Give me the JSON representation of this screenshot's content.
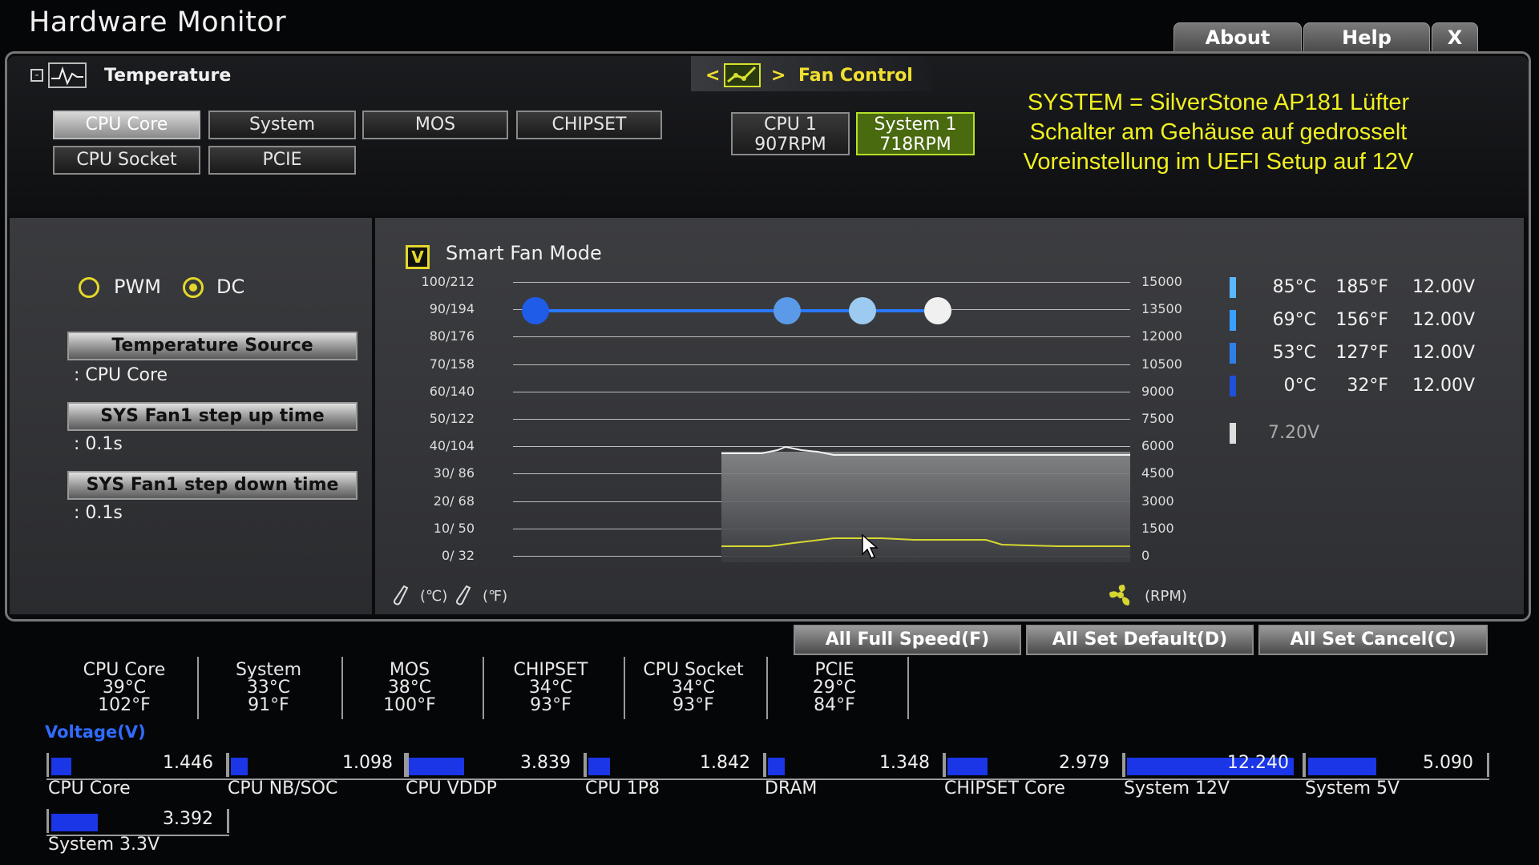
{
  "app": {
    "title": "Hardware Monitor"
  },
  "topbar": {
    "about": "About",
    "help": "Help",
    "close": "X"
  },
  "header": {
    "section_title": "Temperature",
    "fan_control_label": "Fan Control",
    "nav_prev": "<",
    "nav_next": ">"
  },
  "temp_tabs": [
    {
      "label": "CPU Core",
      "active": true
    },
    {
      "label": "System",
      "active": false
    },
    {
      "label": "MOS",
      "active": false
    },
    {
      "label": "CHIPSET",
      "active": false
    },
    {
      "label": "CPU Socket",
      "active": false
    },
    {
      "label": "PCIE",
      "active": false
    }
  ],
  "fans": [
    {
      "name": "CPU 1",
      "rpm": "907RPM",
      "active": false
    },
    {
      "name": "System 1",
      "rpm": "718RPM",
      "active": true
    }
  ],
  "annotation": {
    "line1": "SYSTEM = SilverStone AP181 Lüfter",
    "line2": "Schalter am Gehäuse auf gedrosselt",
    "line3": "Voreinstellung im UEFI Setup auf 12V",
    "color": "#f0f020"
  },
  "mode": {
    "pwm": "PWM",
    "dc": "DC",
    "selected": "DC"
  },
  "settings": {
    "temp_source_label": "Temperature Source",
    "temp_source_value": ": CPU Core",
    "step_up_label": "SYS Fan1 step up time",
    "step_up_value": ": 0.1s",
    "step_down_label": "SYS Fan1 step down time",
    "step_down_value": ": 0.1s"
  },
  "graph": {
    "smart_fan_label": "Smart Fan Mode",
    "smart_fan_checked": "V",
    "unit_c": "(℃)",
    "unit_f": "(℉)",
    "unit_rpm": "(RPM)"
  },
  "chart_data": {
    "type": "line",
    "left_ticks": [
      "100/212",
      "90/194",
      "80/176",
      "70/158",
      "60/140",
      "50/122",
      "40/104",
      "30/  86",
      "20/  68",
      "10/  50",
      "0/  32"
    ],
    "right_ticks": [
      "15000",
      "13500",
      "12000",
      "10500",
      "9000",
      "7500",
      "6000",
      "4500",
      "3000",
      "1500",
      "0"
    ],
    "series": [
      {
        "name": "fan curve",
        "points": [
          {
            "temp_c": 0,
            "volt": 12.0
          },
          {
            "temp_c": 53,
            "volt": 12.0
          },
          {
            "temp_c": 69,
            "volt": 12.0
          },
          {
            "temp_c": 85,
            "volt": 12.0
          }
        ],
        "color": "#2060e0"
      }
    ],
    "rpm_history_band": {
      "level_pct": 41
    },
    "temp_history_band": {
      "level_pct": 6
    }
  },
  "legend": [
    {
      "c": "85°C",
      "f": "185°F",
      "v": "12.00V",
      "color": "#5ab8ff"
    },
    {
      "c": "69°C",
      "f": "156°F",
      "v": "12.00V",
      "color": "#3aa0ff"
    },
    {
      "c": "53°C",
      "f": "127°F",
      "v": "12.00V",
      "color": "#2f7fe8"
    },
    {
      "c": "0°C",
      "f": "32°F",
      "v": "12.00V",
      "color": "#1f50d8"
    }
  ],
  "current_voltage": "7.20V",
  "bottom_buttons": {
    "full": "All Full Speed(F)",
    "default": "All Set Default(D)",
    "cancel": "All Set Cancel(C)"
  },
  "temps": [
    {
      "name": "CPU Core",
      "c": "39°C",
      "f": "102°F"
    },
    {
      "name": "System",
      "c": "33°C",
      "f": "91°F"
    },
    {
      "name": "MOS",
      "c": "38°C",
      "f": "100°F"
    },
    {
      "name": "CHIPSET",
      "c": "34°C",
      "f": "93°F"
    },
    {
      "name": "CPU Socket",
      "c": "34°C",
      "f": "93°F"
    },
    {
      "name": "PCIE",
      "c": "29°C",
      "f": "84°F"
    }
  ],
  "voltage_title": "Voltage(V)",
  "voltages": [
    {
      "name": "CPU Core",
      "value": "1.446",
      "fill": 0.12
    },
    {
      "name": "CPU NB/SOC",
      "value": "1.098",
      "fill": 0.1
    },
    {
      "name": "CPU VDDP",
      "value": "3.839",
      "fill": 0.33
    },
    {
      "name": "CPU 1P8",
      "value": "1.842",
      "fill": 0.13
    },
    {
      "name": "DRAM",
      "value": "1.348",
      "fill": 0.1
    },
    {
      "name": "CHIPSET Core",
      "value": "2.979",
      "fill": 0.24
    },
    {
      "name": "System 12V",
      "value": "12.240",
      "fill": 1.0
    },
    {
      "name": "System 5V",
      "value": "5.090",
      "fill": 0.4
    },
    {
      "name": "System 3.3V",
      "value": "3.392",
      "fill": 0.28
    }
  ]
}
